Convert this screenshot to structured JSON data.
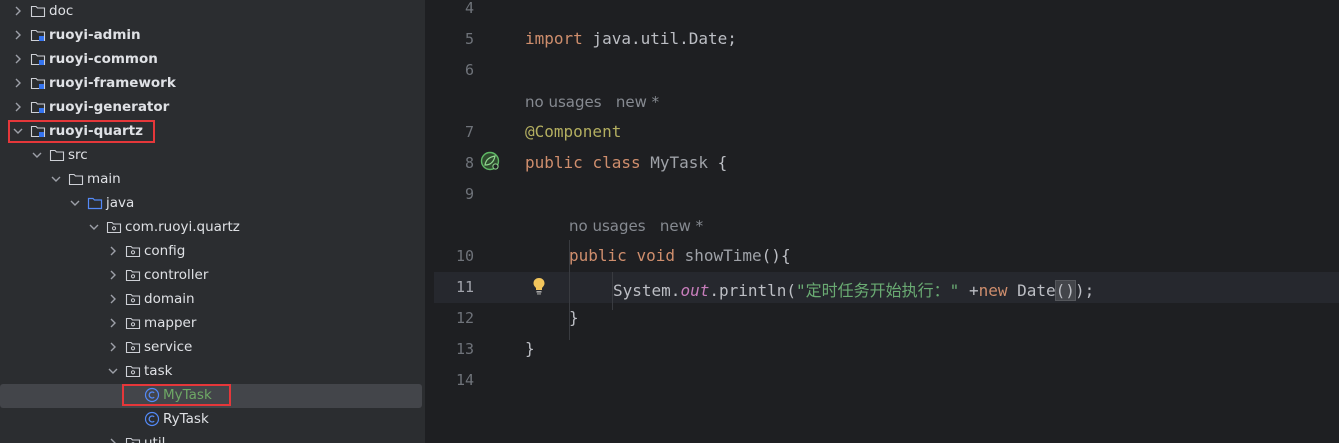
{
  "project_tree": {
    "items": [
      {
        "label": "doc",
        "depth": 0,
        "icon": "folder-icon",
        "expanded": false,
        "bold": false
      },
      {
        "label": "ruoyi-admin",
        "depth": 0,
        "icon": "module-folder-icon",
        "expanded": false,
        "bold": true
      },
      {
        "label": "ruoyi-common",
        "depth": 0,
        "icon": "module-folder-icon",
        "expanded": false,
        "bold": true
      },
      {
        "label": "ruoyi-framework",
        "depth": 0,
        "icon": "module-folder-icon",
        "expanded": false,
        "bold": true
      },
      {
        "label": "ruoyi-generator",
        "depth": 0,
        "icon": "module-folder-icon",
        "expanded": false,
        "bold": true
      },
      {
        "label": "ruoyi-quartz",
        "depth": 0,
        "icon": "module-folder-icon",
        "expanded": true,
        "bold": true
      },
      {
        "label": "src",
        "depth": 1,
        "icon": "folder-icon",
        "expanded": true,
        "bold": false
      },
      {
        "label": "main",
        "depth": 2,
        "icon": "folder-icon",
        "expanded": true,
        "bold": false
      },
      {
        "label": "java",
        "depth": 3,
        "icon": "source-folder-icon",
        "expanded": true,
        "bold": false
      },
      {
        "label": "com.ruoyi.quartz",
        "depth": 4,
        "icon": "package-icon",
        "expanded": true,
        "bold": false
      },
      {
        "label": "config",
        "depth": 5,
        "icon": "package-icon",
        "expanded": false,
        "bold": false
      },
      {
        "label": "controller",
        "depth": 5,
        "icon": "package-icon",
        "expanded": false,
        "bold": false
      },
      {
        "label": "domain",
        "depth": 5,
        "icon": "package-icon",
        "expanded": false,
        "bold": false
      },
      {
        "label": "mapper",
        "depth": 5,
        "icon": "package-icon",
        "expanded": false,
        "bold": false
      },
      {
        "label": "service",
        "depth": 5,
        "icon": "package-icon",
        "expanded": false,
        "bold": false
      },
      {
        "label": "task",
        "depth": 5,
        "icon": "package-icon",
        "expanded": true,
        "bold": false
      },
      {
        "label": "MyTask",
        "depth": 6,
        "icon": "java-class-icon",
        "leaf": true,
        "selected": true,
        "color": "green"
      },
      {
        "label": "RyTask",
        "depth": 6,
        "icon": "java-class-icon",
        "leaf": true
      },
      {
        "label": "util",
        "depth": 5,
        "icon": "package-icon",
        "expanded": false,
        "bold": false
      }
    ]
  },
  "editor": {
    "current_line": "11",
    "lines": [
      {
        "num": "4",
        "type": "empty"
      },
      {
        "num": "5",
        "type": "import",
        "kw": "import",
        "rest": " java.util.Date;"
      },
      {
        "num": "6",
        "type": "empty"
      },
      {
        "num": "",
        "type": "hint",
        "text": "no usages   new *"
      },
      {
        "num": "7",
        "type": "annotation",
        "text": "@Component"
      },
      {
        "num": "8",
        "type": "classdecl",
        "kw1": "public",
        "kw2": "class",
        "name": "MyTask",
        "rest": " {"
      },
      {
        "num": "9",
        "type": "empty"
      },
      {
        "num": "",
        "type": "hint2",
        "text": "no usages   new *"
      },
      {
        "num": "10",
        "type": "methoddecl",
        "kw1": "public",
        "kw2": "void",
        "name": "showTime",
        "rest": "(){"
      },
      {
        "num": "11",
        "type": "println",
        "obj": "System.",
        "field": "out",
        "call": ".println(",
        "str": "\"定时任务开始执行：\"",
        "plus": " +",
        "kwnew": "new",
        "ctor": " Date",
        "paren": "()",
        "end": ");"
      },
      {
        "num": "12",
        "type": "close1",
        "text": "}"
      },
      {
        "num": "13",
        "type": "close0",
        "text": "}"
      },
      {
        "num": "14",
        "type": "empty"
      }
    ]
  },
  "colors": {
    "highlight_box": "#e5373a",
    "selection": "#43454a",
    "keyword": "#cf8e6d",
    "annotation": "#b3ae60",
    "string": "#6aab73",
    "method": "#56a8f5"
  }
}
